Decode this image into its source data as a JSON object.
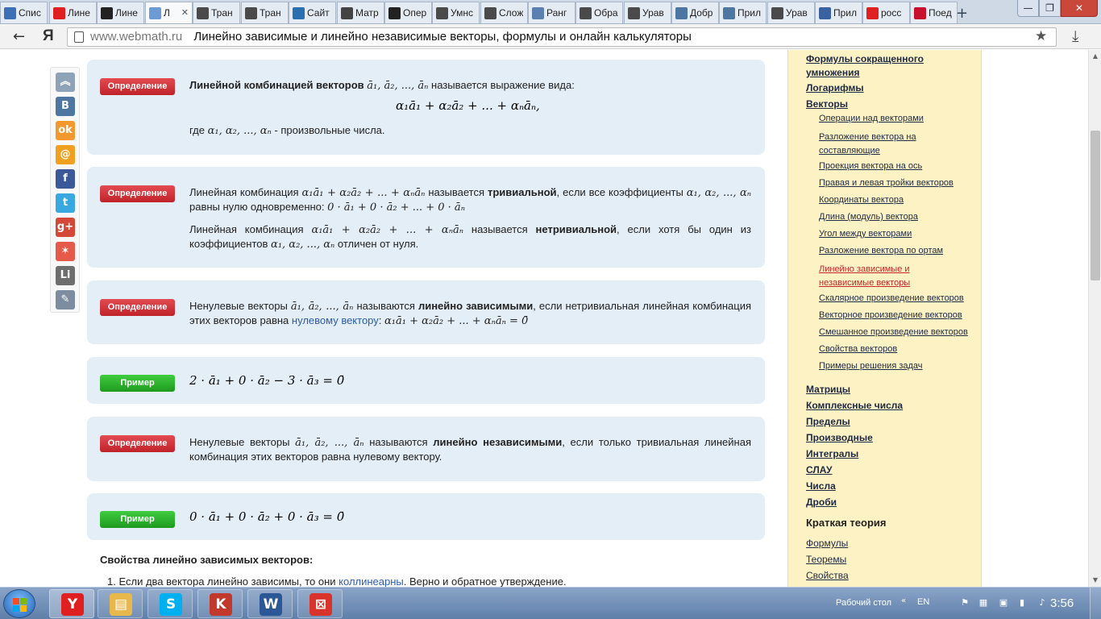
{
  "browser": {
    "tabs": [
      {
        "label": "Спис",
        "icon": "document-icon",
        "color": "#3d6fb6"
      },
      {
        "label": "Лине",
        "icon": "yandex-icon",
        "color": "#e02020"
      },
      {
        "label": "Лине",
        "icon": "clover-icon",
        "color": "#222222"
      },
      {
        "label": "Л",
        "icon": "webmath-icon",
        "color": "#6b9bd2",
        "active": true
      },
      {
        "label": "Тран",
        "icon": "math-formula-icon",
        "color": "#4a4a4a"
      },
      {
        "label": "Тран",
        "icon": "math-formula-icon",
        "color": "#4a4a4a"
      },
      {
        "label": "Сайт",
        "icon": "wordpress-icon",
        "color": "#2a6fb0"
      },
      {
        "label": "Матр",
        "icon": "sigma-icon",
        "color": "#444444"
      },
      {
        "label": "Опер",
        "icon": "clover-icon",
        "color": "#222222"
      },
      {
        "label": "Умнс",
        "icon": "math-formula-icon",
        "color": "#4a4a4a"
      },
      {
        "label": "Слож",
        "icon": "math-formula-icon",
        "color": "#4a4a4a"
      },
      {
        "label": "Ранг",
        "icon": "book-icon",
        "color": "#5a7fb0"
      },
      {
        "label": "Обра",
        "icon": "math-formula-icon",
        "color": "#4a4a4a"
      },
      {
        "label": "Урав",
        "icon": "math-formula-icon",
        "color": "#4a4a4a"
      },
      {
        "label": "Добр",
        "icon": "vk-icon",
        "color": "#4d76a1"
      },
      {
        "label": "Прил",
        "icon": "vk-icon",
        "color": "#4d76a1"
      },
      {
        "label": "Урав",
        "icon": "math-formula-icon",
        "color": "#4a4a4a"
      },
      {
        "label": "Прил",
        "icon": "pause-icon",
        "color": "#3a62a0"
      },
      {
        "label": "росс",
        "icon": "yandex-icon",
        "color": "#e02020"
      },
      {
        "label": "Поед",
        "icon": "first-channel-icon",
        "color": "#c8102e"
      }
    ],
    "new_tab": "+",
    "window_buttons": {
      "minimize": "—",
      "maximize": "❐",
      "close": "✕"
    },
    "back": "←",
    "yandex_button": "Я",
    "url_domain": "www.webmath.ru",
    "page_title": "Линейно зависимые и линейно независимые векторы, формулы и онлайн калькуляторы",
    "star": "★",
    "download": "⤓"
  },
  "share_panel": [
    {
      "name": "scroll-top-icon",
      "glyph": "︽",
      "color": "#8fa3b8"
    },
    {
      "name": "vk-share-icon",
      "glyph": "В",
      "color": "#4d76a1"
    },
    {
      "name": "odnoklassniki-share-icon",
      "glyph": "ok",
      "color": "#f3982e"
    },
    {
      "name": "mail-share-icon",
      "glyph": "@",
      "color": "#f0a020"
    },
    {
      "name": "facebook-share-icon",
      "glyph": "f",
      "color": "#3b5998"
    },
    {
      "name": "twitter-share-icon",
      "glyph": "t",
      "color": "#3aa8e0"
    },
    {
      "name": "googleplus-share-icon",
      "glyph": "g+",
      "color": "#d34836"
    },
    {
      "name": "myworld-share-icon",
      "glyph": "✶",
      "color": "#e65a4a"
    },
    {
      "name": "liveinternet-share-icon",
      "glyph": "Li",
      "color": "#6e6e6e"
    },
    {
      "name": "bookmark-share-icon",
      "glyph": "✎",
      "color": "#7d8da0"
    }
  ],
  "content": {
    "badge_definition": "Определение",
    "badge_example": "Пример",
    "def1": {
      "bold": "Линейной комбинацией векторов",
      "vars": "ā₁, ā₂, ..., āₙ",
      "rest": "называется выражение вида:",
      "formula": "α₁ā₁ + α₂ā₂ + ... + αₙāₙ,",
      "where": "где",
      "coefs": "α₁, α₂, ..., αₙ",
      "where_rest": "- произвольные числа."
    },
    "def2": {
      "p1_a": "Линейная комбинация",
      "combo": "α₁ā₁ + α₂ā₂ + ... + αₙāₙ",
      "p1_b": "называется",
      "trivial": "тривиальной",
      "p1_c": ", если все коэффициенты",
      "coefs": "α₁, α₂, ..., αₙ",
      "p1_d": "равны нулю одновременно:",
      "zero_combo": "0 · ā₁ + 0 · ā₂ + ... + 0 · āₙ",
      "p2_a": "Линейная комбинация",
      "p2_b": "называется",
      "nontrivial": "нетривиальной",
      "p2_c": ", если хотя бы один из коэффициентов",
      "p2_d": "отличен от нуля."
    },
    "def3": {
      "a": "Ненулевые векторы",
      "vars": "ā₁, ā₂, ..., āₙ",
      "b": "называются",
      "bold": "линейно зависимыми",
      "c": ", если нетривиальная линейная комбинация этих векторов равна",
      "link": "нулевому вектору",
      "d": ":",
      "formula": "α₁ā₁ + α₂ā₂ + ... + αₙāₙ = 0̄"
    },
    "ex1": {
      "formula": "2 · ā₁ + 0 · ā₂ − 3 · ā₃ = 0̄"
    },
    "def4": {
      "a": "Ненулевые векторы",
      "vars": "ā₁, ā₂, ..., āₙ",
      "b": "называются",
      "bold": "линейно независимыми",
      "c": ", если только тривиальная линейная комбинация этих векторов равна нулевому вектору."
    },
    "ex2": {
      "formula": "0 · ā₁ + 0 · ā₂ + 0 · ā₃ = 0̄"
    },
    "props_heading": "Свойства линейно зависимых векторов:",
    "props_item1_a": "1. Если два вектора линейно зависимы, то они",
    "props_item1_link": "коллинеарны",
    "props_item1_b": ". Верно и обратное утверждение."
  },
  "sidebar": {
    "top_link": "Формулы сокращенного умножения",
    "main_links_top": [
      "Логарифмы",
      "Векторы"
    ],
    "sub_links": [
      "Операции над векторами",
      "Разложение вектора на составляющие",
      "Проекция вектора на ось",
      "Правая и левая тройки векторов",
      "Координаты вектора",
      "Длина (модуль) вектора",
      "Угол между векторами",
      "Разложение вектора по ортам",
      "Линейно зависимые и независимые векторы",
      "Скалярное произведение векторов",
      "Векторное произведение векторов",
      "Смешанное произведение векторов",
      "Свойства векторов",
      "Примеры решения задач"
    ],
    "main_links_bottom": [
      "Матрицы",
      "Комплексные числа",
      "Пределы",
      "Производные",
      "Интегралы",
      "СЛАУ",
      "Числа",
      "Дроби"
    ],
    "theory_heading": "Краткая теория",
    "theory_links": [
      "Формулы",
      "Теоремы",
      "Свойства"
    ]
  },
  "scrollbar": {
    "up": "▲",
    "down": "▼"
  },
  "taskbar": {
    "apps": [
      {
        "name": "yandex-browser-icon",
        "glyph": "Y",
        "color": "#e02020",
        "active": true
      },
      {
        "name": "explorer-icon",
        "glyph": "▤",
        "color": "#e8b84a"
      },
      {
        "name": "skype-icon",
        "glyph": "S",
        "color": "#00aff0"
      },
      {
        "name": "kaspersky-icon",
        "glyph": "K",
        "color": "#c0392b"
      },
      {
        "name": "word-icon",
        "glyph": "W",
        "color": "#2b5797"
      },
      {
        "name": "kingsoft-icon",
        "glyph": "⊠",
        "color": "#d9342b"
      }
    ],
    "desktop_label": "Рабочий стол",
    "tray_arrows": "«",
    "language": "EN",
    "tray_icons": [
      "flag-icon",
      "network-icon",
      "shield-icon",
      "power-icon",
      "volume-icon"
    ],
    "tray_glyphs": [
      "⚑",
      "▦",
      "▣",
      "▮",
      "♪"
    ],
    "clock": "3:56"
  }
}
